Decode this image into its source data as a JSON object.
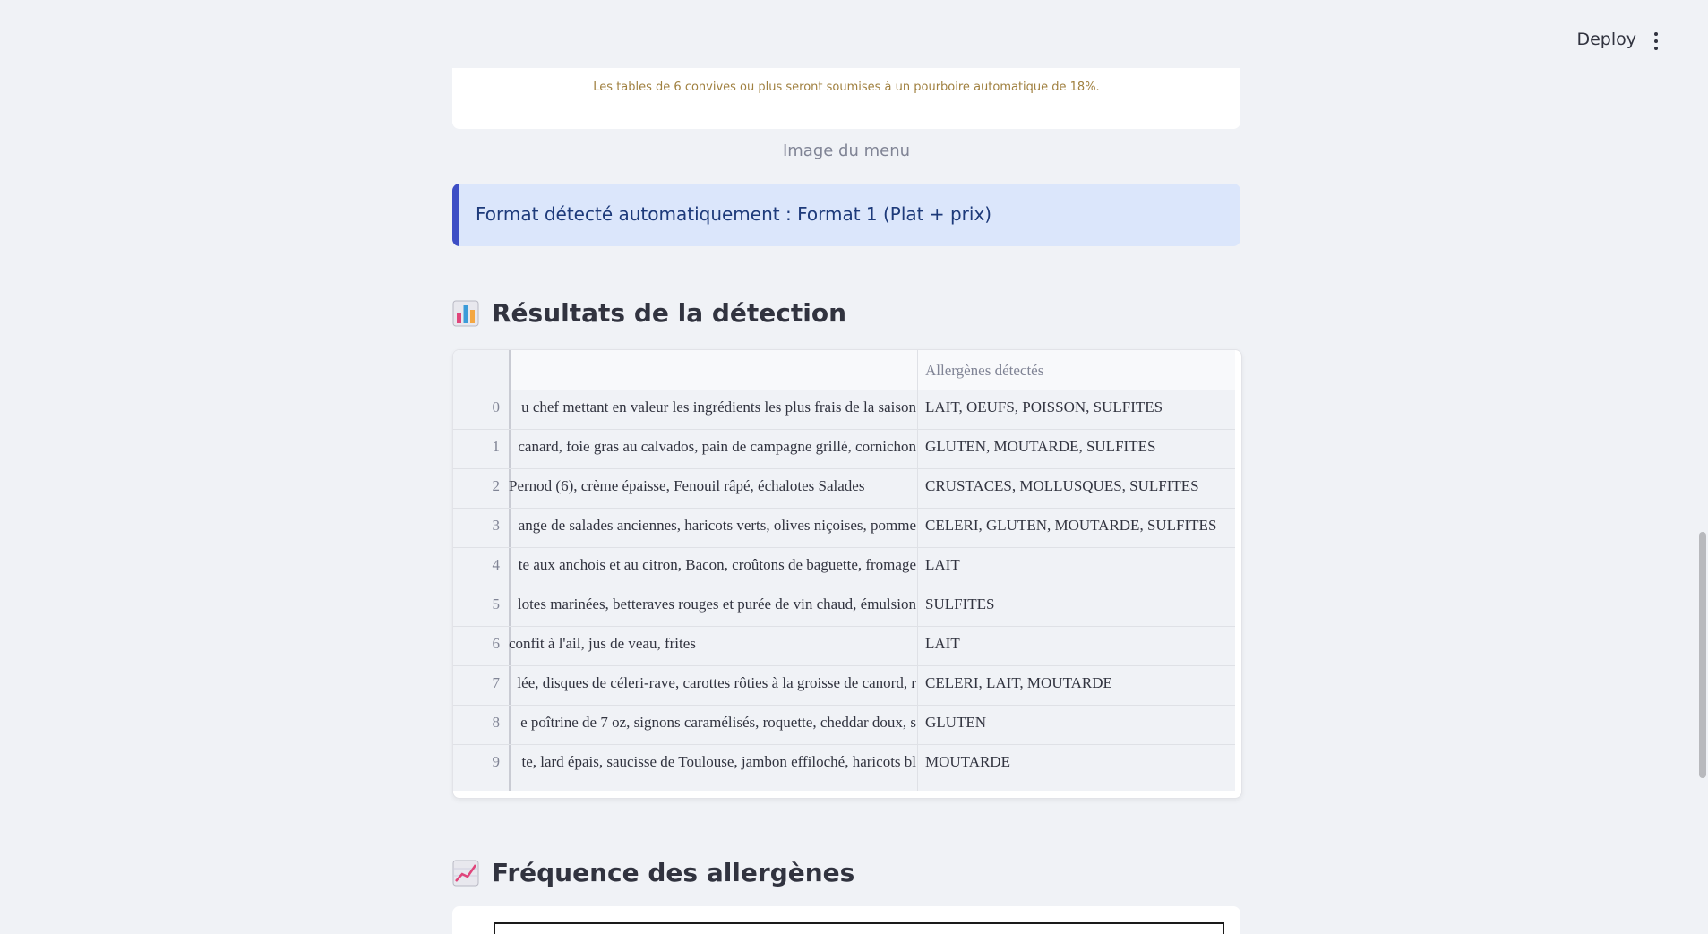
{
  "header": {
    "deploy_label": "Deploy",
    "menu_icon": "kebab-menu-icon"
  },
  "menu_image": {
    "visible_text": "Les tables de 6 convives ou plus seront soumises à un pourboire automatique de 18%.",
    "caption": "Image du menu"
  },
  "info_box": {
    "text": "Format détecté automatiquement : Format 1 (Plat + prix)",
    "accent_color": "#3d4ec5"
  },
  "results": {
    "title": "Résultats de la détection",
    "icon": "bar-chart-icon",
    "columns": [
      "",
      "Allergènes détectés"
    ],
    "rows": [
      {
        "index": "0",
        "dish": "u chef mettant en valeur les ingrédients les plus frais de la saison",
        "allergens": "LAIT, OEUFS, POISSON, SULFITES"
      },
      {
        "index": "1",
        "dish": "canard, foie gras au calvados, pain de campagne grillé, cornichon",
        "allergens": "GLUTEN, MOUTARDE, SULFITES"
      },
      {
        "index": "2",
        "dish": "Pernod (6), crème épaisse, Fenouil râpé, échalotes Salades",
        "allergens": "CRUSTACES, MOLLUSQUES, SULFITES"
      },
      {
        "index": "3",
        "dish": "ange de salades anciennes, haricots verts, olives niçoises, pomme",
        "allergens": "CELERI, GLUTEN, MOUTARDE, SULFITES"
      },
      {
        "index": "4",
        "dish": "te aux anchois et au citron, Bacon, croûtons de baguette, fromage",
        "allergens": "LAIT"
      },
      {
        "index": "5",
        "dish": "lotes marinées, betteraves rouges et purée de vin chaud, émulsion",
        "allergens": "SULFITES"
      },
      {
        "index": "6",
        "dish": "confit à l'ail, jus de veau, frites",
        "allergens": "LAIT"
      },
      {
        "index": "7",
        "dish": "lée, disques de céleri-rave, carottes rôties à la groisse de canord, r",
        "allergens": "CELERI, LAIT, MOUTARDE"
      },
      {
        "index": "8",
        "dish": "e poîtrine de 7 oz, signons caramélisés, roquette, cheddar doux, s",
        "allergens": "GLUTEN"
      },
      {
        "index": "9",
        "dish": "te, lard épais, saucisse de Toulouse, jambon effiloché, haricots bl",
        "allergens": "MOUTARDE"
      }
    ]
  },
  "frequency": {
    "title": "Fréquence des allergènes",
    "icon": "line-chart-icon"
  }
}
